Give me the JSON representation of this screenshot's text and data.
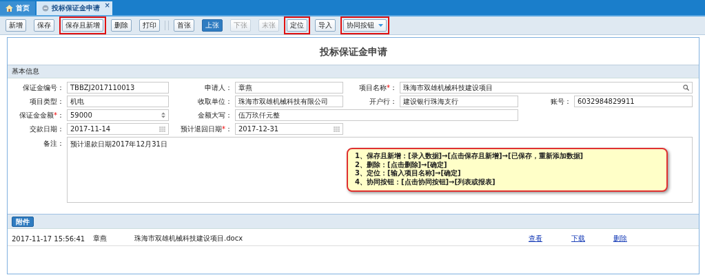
{
  "tabs": [
    {
      "label": "首页",
      "kind": "home",
      "selected": false
    },
    {
      "label": "投标保证金申请",
      "kind": "doc",
      "selected": true,
      "close": "×"
    }
  ],
  "toolbar": [
    {
      "label": "新增",
      "kind": "button",
      "pressed": false,
      "disabled": false,
      "highlighted": false
    },
    {
      "label": "保存",
      "kind": "button",
      "pressed": false,
      "disabled": false,
      "highlighted": false
    },
    {
      "label": "保存且新增",
      "kind": "button",
      "pressed": false,
      "disabled": false,
      "highlighted": true
    },
    {
      "label": "删除",
      "kind": "button",
      "pressed": false,
      "disabled": false,
      "highlighted": false
    },
    {
      "label": "打印",
      "kind": "button",
      "pressed": false,
      "disabled": false,
      "highlighted": false
    },
    {
      "kind": "separator"
    },
    {
      "label": "首张",
      "kind": "button",
      "pressed": false,
      "disabled": false,
      "highlighted": false
    },
    {
      "label": "上张",
      "kind": "button",
      "pressed": true,
      "disabled": false,
      "highlighted": false
    },
    {
      "label": "下张",
      "kind": "button",
      "pressed": false,
      "disabled": true,
      "highlighted": false
    },
    {
      "label": "末张",
      "kind": "button",
      "pressed": false,
      "disabled": true,
      "highlighted": false
    },
    {
      "label": "定位",
      "kind": "button",
      "pressed": false,
      "disabled": false,
      "highlighted": true
    },
    {
      "label": "导入",
      "kind": "button",
      "pressed": false,
      "disabled": false,
      "highlighted": false
    },
    {
      "label": "协同按钮",
      "kind": "dropdown",
      "pressed": false,
      "disabled": false,
      "highlighted": true
    }
  ],
  "form": {
    "title": "投标保证金申请",
    "section": "基本信息",
    "rows": [
      [
        {
          "label": "保证金编号",
          "colon": "：",
          "value": "TBBZJ2017110013",
          "kind": "text"
        },
        {
          "label": "申请人",
          "colon": "：",
          "value": "章燕",
          "kind": "text"
        },
        {
          "label": "项目名称",
          "asterisk": "*",
          "colon": "：",
          "value": "珠海市双雄机械科技建设项目",
          "kind": "search"
        }
      ],
      [
        {
          "label": "项目类型",
          "colon": "：",
          "value": "机电",
          "kind": "text"
        },
        {
          "label": "收取单位",
          "colon": "：",
          "value": "珠海市双雄机械科技有限公司",
          "kind": "text"
        },
        {
          "label": "开户行",
          "colon": "：",
          "value": "建设银行珠海支行",
          "kind": "text"
        },
        {
          "label": "账号",
          "colon": "：",
          "value": "6032984829911",
          "kind": "text"
        }
      ],
      [
        {
          "label": "保证金金额",
          "asterisk": "*",
          "colon": "：",
          "value": "59000",
          "kind": "spinner"
        },
        {
          "label": "金额大写",
          "colon": "：",
          "value": "伍万玖仟元整",
          "kind": "text"
        }
      ],
      [
        {
          "label": "交款日期",
          "colon": "：",
          "value": "2017-11-14",
          "kind": "date"
        },
        {
          "label": "预计退回日期",
          "asterisk": "*",
          "colon": "：",
          "value": "2017-12-31",
          "kind": "date"
        }
      ]
    ],
    "remark": {
      "label": "备注",
      "colon": "：",
      "value": "预计退款日期2017年12月31日"
    }
  },
  "callout": [
    "1、保存且新增：[录入数据]→[点击保存且新增]→[已保存，重新添加数据]",
    "2、删除：[点击删除]→[确定]",
    "3、定位：[输入项目名称]→[确定]",
    "4、协同按钮：[点击协同按钮]→[列表或报表]"
  ],
  "attachments": {
    "button": "附件",
    "rows": [
      {
        "time": "2017-11-17 15:56:41",
        "person": "章燕",
        "file": "珠海市双雄机械科技建设项目.docx",
        "actions": [
          "查看",
          "下载",
          "删除"
        ]
      }
    ]
  }
}
